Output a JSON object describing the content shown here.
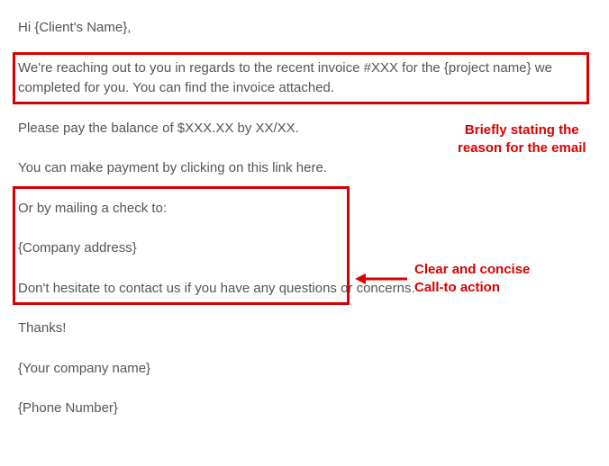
{
  "email": {
    "greeting": "Hi {Client's Name},",
    "intro": "We're reaching out to you in regards to the recent invoice #XXX for the {project name} we completed for you. You can find the invoice attached.",
    "balance": "Please pay the balance of $XXX.XX by XX/XX.",
    "paymentLink": "You can make payment by clicking on this link here.",
    "mailingCheck": "Or by mailing a check to:",
    "companyAddress": "{Company address}",
    "contact": "Don't hesitate to contact us if you have any questions or concerns.",
    "thanks": "Thanks!",
    "companyName": "{Your company name}",
    "phone": "{Phone Number}"
  },
  "annotations": {
    "reason1": "Briefly stating the",
    "reason2": "reason for the email",
    "cta1": "Clear and concise",
    "cta2": "Call-to action"
  }
}
